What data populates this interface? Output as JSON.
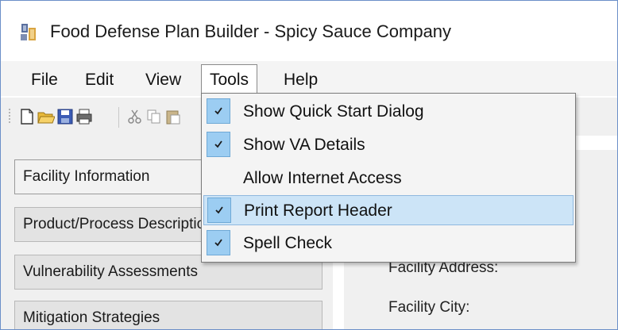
{
  "window": {
    "title": "Food Defense Plan Builder - Spicy Sauce Company",
    "icon": "app-logo-icon"
  },
  "menubar": {
    "items": [
      {
        "label": "File"
      },
      {
        "label": "Edit"
      },
      {
        "label": "View"
      },
      {
        "label": "Tools",
        "open": true
      },
      {
        "label": "Help"
      }
    ]
  },
  "toolbar": {
    "buttons": [
      "new-document-icon",
      "open-folder-icon",
      "save-icon",
      "print-icon",
      "cut-icon",
      "copy-icon",
      "paste-icon"
    ]
  },
  "tools_menu": {
    "items": [
      {
        "label": "Show Quick Start Dialog",
        "checked": true,
        "highlighted": false
      },
      {
        "label": "Show VA Details",
        "checked": true,
        "highlighted": false
      },
      {
        "label": "Allow Internet Access",
        "checked": false,
        "highlighted": false
      },
      {
        "label": "Print Report Header",
        "checked": true,
        "highlighted": true
      },
      {
        "label": "Spell Check",
        "checked": true,
        "highlighted": false
      }
    ]
  },
  "navigation": {
    "items": [
      {
        "label": "Facility Information",
        "selected": true
      },
      {
        "label": "Product/Process Description",
        "selected": false
      },
      {
        "label": "Vulnerability Assessments",
        "selected": false
      },
      {
        "label": "Mitigation Strategies",
        "selected": false
      }
    ]
  },
  "form": {
    "facility_address_label": "Facility Address:",
    "facility_city_label": "Facility City:"
  },
  "colors": {
    "highlight": "#cce4f7",
    "check_bg": "#9ccdf2",
    "window_border": "#6b8fc8"
  }
}
